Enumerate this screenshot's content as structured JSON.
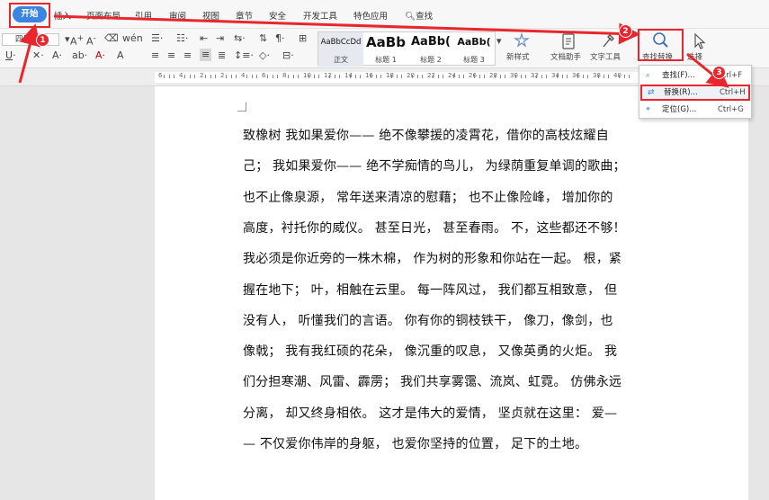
{
  "menu": {
    "start": "开始",
    "items": [
      "插入",
      "页面布局",
      "引用",
      "审阅",
      "视图",
      "章节",
      "安全",
      "开发工具",
      "特色应用"
    ],
    "search": "查找"
  },
  "ribbon": {
    "font_name": "四号",
    "styles": [
      {
        "sample": "AaBbCcDd",
        "label": "正文"
      },
      {
        "sample": "AaBb",
        "label": "标题 1"
      },
      {
        "sample": "AaBb(",
        "label": "标题 2"
      },
      {
        "sample": "AaBb(",
        "label": "标题 3"
      }
    ],
    "new_style": "新样式",
    "doc_helper": "文档助手",
    "text_tools": "文字工具",
    "find_replace": "查找替换",
    "select": "选择"
  },
  "ruler": {
    "numbers": [
      "6",
      "4",
      "2",
      "2",
      "4",
      "6",
      "8",
      "10",
      "12",
      "14",
      "16",
      "18",
      "20",
      "22",
      "24",
      "26",
      "28",
      "30",
      "32",
      "34",
      "36",
      "38",
      "40"
    ]
  },
  "dropdown": [
    {
      "label": "查找(F)...",
      "shortcut": "Ctrl+F",
      "icon": "search-icon"
    },
    {
      "label": "替换(R)...",
      "shortcut": "Ctrl+H",
      "icon": "replace-icon"
    },
    {
      "label": "定位(G)...",
      "shortcut": "Ctrl+G",
      "icon": "goto-icon"
    }
  ],
  "document": {
    "lines": [
      "致橡树 我如果爱你—— 绝不像攀援的凌霄花，借你的高枝炫耀自",
      "己； 我如果爱你—— 绝不学痴情的鸟儿， 为绿荫重复单调的歌曲；",
      "也不止像泉源， 常年送来清凉的慰藉； 也不止像险峰， 增加你的",
      "高度，衬托你的威仪。 甚至日光， 甚至春雨。 不，这些都还不够！",
      "我必须是你近旁的一株木棉， 作为树的形象和你站在一起。 根，紧",
      "握在地下； 叶，相触在云里。 每一阵风过， 我们都互相致意， 但",
      "没有人， 听懂我们的言语。 你有你的铜枝铁干， 像刀，像剑，也",
      "像戟； 我有我红硕的花朵， 像沉重的叹息， 又像英勇的火炬。 我",
      "们分担寒潮、风雷、霹雳； 我们共享雾霭、流岚、虹霓。 仿佛永远",
      "分离， 却又终身相依。 这才是伟大的爱情， 坚贞就在这里： 爱—",
      "— 不仅爱你伟岸的身躯， 也爱你坚持的位置， 足下的土地。"
    ]
  },
  "annotations": {
    "badges": [
      "1",
      "2",
      "3"
    ]
  },
  "colors": {
    "accent": "#3b84e0",
    "annotation_red": "#e8262d"
  }
}
